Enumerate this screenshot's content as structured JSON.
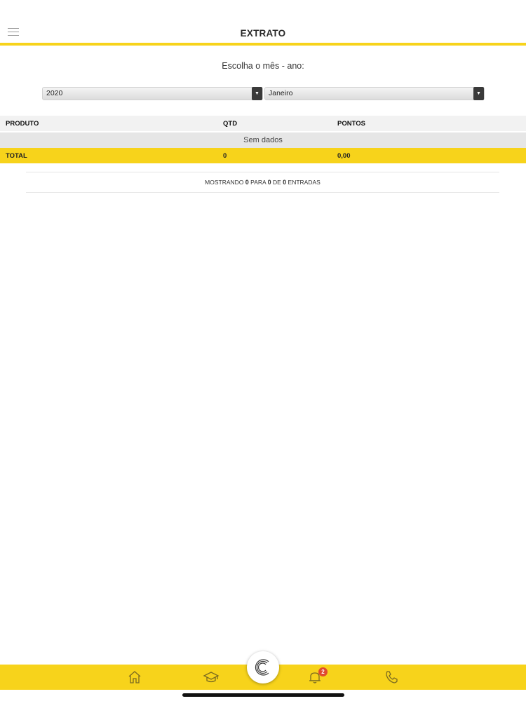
{
  "header": {
    "title": "EXTRATO",
    "menu_icon": "hamburger-icon"
  },
  "filter": {
    "prompt": "Escolha o mês - ano:",
    "year": "2020",
    "month": "Janeiro"
  },
  "table": {
    "columns": [
      "PRODUTO",
      "QTD",
      "PONTOS"
    ],
    "empty_message": "Sem dados",
    "total": {
      "label": "TOTAL",
      "qtd": "0",
      "pontos": "0,00"
    }
  },
  "pagination": {
    "prefix": "MOSTRANDO",
    "from": "0",
    "mid1": "PARA",
    "to": "0",
    "mid2": "DE",
    "total": "0",
    "suffix": "ENTRADAS"
  },
  "bottom_nav": {
    "items": [
      "home-icon",
      "graduation-cap-icon",
      "logo-icon",
      "bell-icon",
      "phone-icon"
    ],
    "notification_count": "2"
  },
  "colors": {
    "accent": "#f7d31b",
    "badge": "#e04a2e"
  }
}
